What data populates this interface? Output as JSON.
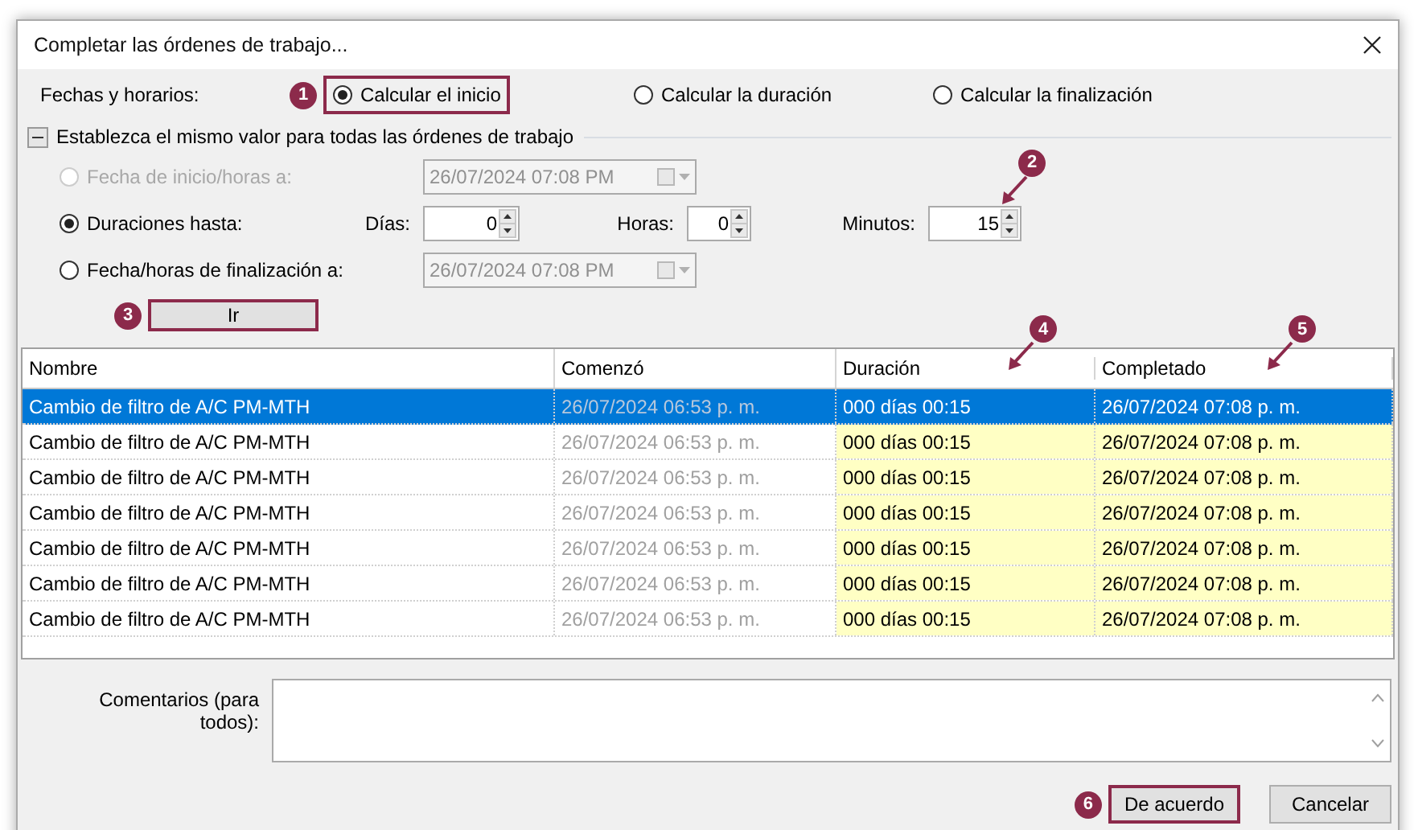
{
  "window": {
    "title": "Completar las órdenes de trabajo..."
  },
  "schedule": {
    "label": "Fechas y horarios:",
    "options": [
      {
        "label": "Calcular el inicio",
        "selected": true,
        "callout": {
          "number": "1",
          "kind": "badge"
        }
      },
      {
        "label": "Calcular la duración",
        "selected": false
      },
      {
        "label": "Calcular la finalización",
        "selected": false
      }
    ]
  },
  "group": {
    "title": "Establezca el mismo valor para todas las órdenes de trabajo",
    "expanded": true,
    "options": [
      {
        "kind": "date",
        "label": "Fecha de inicio/horas a:",
        "selected": false,
        "disabled": true,
        "picker": {
          "value": "26/07/2024 07:08 PM",
          "disabled": true
        }
      },
      {
        "kind": "durations",
        "label": "Duraciones hasta:",
        "selected": true,
        "disabled": false,
        "fields": [
          {
            "label": "Días:",
            "value": "0"
          },
          {
            "label": "Horas:",
            "value": "0"
          },
          {
            "label": "Minutos:",
            "value": "15",
            "callout": {
              "number": "2",
              "kind": "arrow"
            }
          }
        ]
      },
      {
        "kind": "date",
        "label": "Fecha/horas de finalización a:",
        "selected": false,
        "disabled": false,
        "picker": {
          "value": "26/07/2024 07:08 PM",
          "disabled": true
        }
      }
    ],
    "go_button": {
      "label": "Ir",
      "callout": {
        "number": "3",
        "kind": "badge"
      }
    }
  },
  "table": {
    "columns": [
      {
        "label": "Nombre",
        "kind": "name"
      },
      {
        "label": "Comenzó",
        "kind": "readonly"
      },
      {
        "label": "Duración",
        "kind": "computed",
        "callout": {
          "number": "4",
          "kind": "arrow"
        }
      },
      {
        "label": "Completado",
        "kind": "computed",
        "callout": {
          "number": "5",
          "kind": "arrow"
        }
      }
    ],
    "rows": [
      {
        "selected": true,
        "cells": [
          "Cambio de filtro de A/C PM-MTH",
          "26/07/2024 06:53 p. m.",
          "000 días 00:15",
          "26/07/2024 07:08 p. m."
        ]
      },
      {
        "selected": false,
        "cells": [
          "Cambio de filtro de A/C PM-MTH",
          "26/07/2024 06:53 p. m.",
          "000 días 00:15",
          "26/07/2024 07:08 p. m."
        ]
      },
      {
        "selected": false,
        "cells": [
          "Cambio de filtro de A/C PM-MTH",
          "26/07/2024 06:53 p. m.",
          "000 días 00:15",
          "26/07/2024 07:08 p. m."
        ]
      },
      {
        "selected": false,
        "cells": [
          "Cambio de filtro de A/C PM-MTH",
          "26/07/2024 06:53 p. m.",
          "000 días 00:15",
          "26/07/2024 07:08 p. m."
        ]
      },
      {
        "selected": false,
        "cells": [
          "Cambio de filtro de A/C PM-MTH",
          "26/07/2024 06:53 p. m.",
          "000 días 00:15",
          "26/07/2024 07:08 p. m."
        ]
      },
      {
        "selected": false,
        "cells": [
          "Cambio de filtro de A/C PM-MTH",
          "26/07/2024 06:53 p. m.",
          "000 días 00:15",
          "26/07/2024 07:08 p. m."
        ]
      },
      {
        "selected": false,
        "cells": [
          "Cambio de filtro de A/C PM-MTH",
          "26/07/2024 06:53 p. m.",
          "000 días 00:15",
          "26/07/2024 07:08 p. m."
        ]
      }
    ]
  },
  "comments": {
    "label": "Comentarios (para todos):"
  },
  "buttons": [
    {
      "label": "De acuerdo",
      "callout": {
        "number": "6",
        "kind": "badge"
      }
    },
    {
      "label": "Cancelar"
    }
  ]
}
